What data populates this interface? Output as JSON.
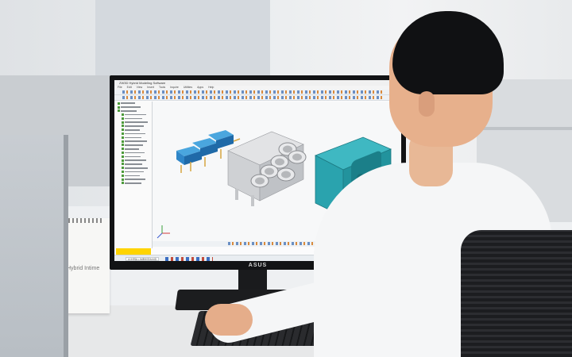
{
  "scene": {
    "description_free": true
  },
  "monitor": {
    "brand": "ASUS"
  },
  "cad_app": {
    "title": "ZW3D  Hybrid Modeling Software",
    "menu_items": [
      "File",
      "Edit",
      "View",
      "Insert",
      "Tools",
      "Inquire",
      "Utilities",
      "Apps",
      "Help"
    ],
    "tree_rows": 22,
    "bottom_sticker": "",
    "taskbar_search_placeholder": "在这里输入你要搜索的内容"
  },
  "calendar": {
    "brand": "Hybrid Intime"
  },
  "colors": {
    "part_teal": "#2aa3ae",
    "part_blue": "#2f86c8",
    "part_grey": "#cfd1d4",
    "shirt": "#f5f6f7",
    "hair": "#101113"
  }
}
